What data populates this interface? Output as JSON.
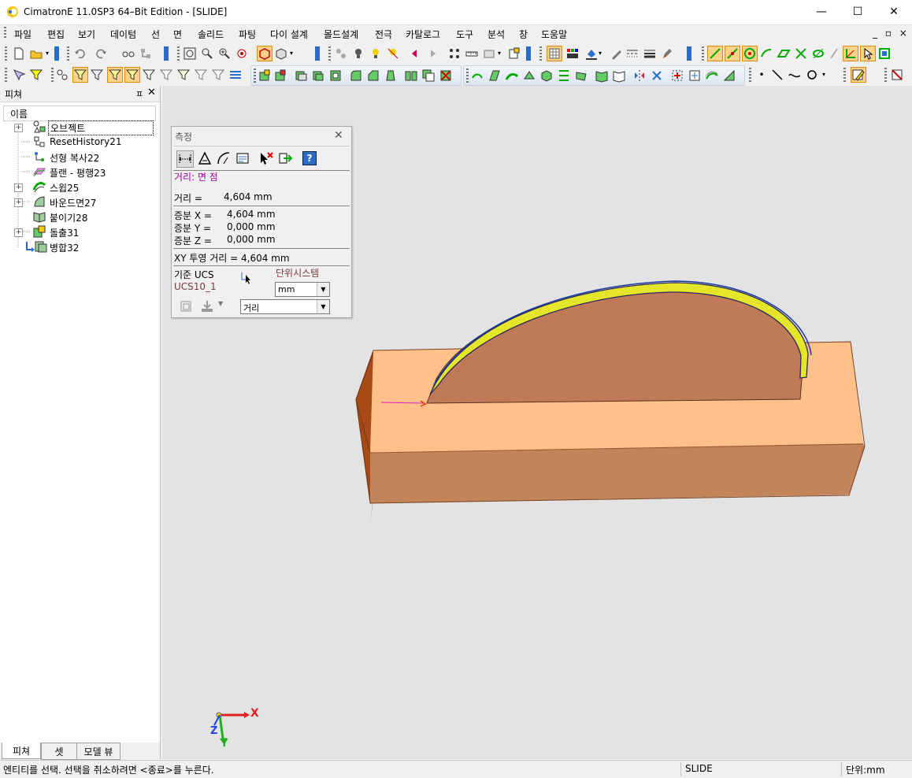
{
  "window": {
    "title": "CimatronE 11.0SP3 64–Bit Edition - [SLIDE]",
    "minimize": "—",
    "maximize": "☐",
    "close": "✕"
  },
  "menu": {
    "items": [
      "파일",
      "편집",
      "보기",
      "데이텀",
      "선",
      "면",
      "솔리드",
      "파팅",
      "다이 설계",
      "몰드설계",
      "전극",
      "카탈로그",
      "도구",
      "분석",
      "창",
      "도움말"
    ],
    "right_controls": "_ ▫ ×"
  },
  "feature_panel": {
    "title": "피쳐",
    "pin": "ㅍ",
    "close": "✕",
    "column_header": "이름",
    "items": [
      {
        "label": "오브젝트",
        "expandable": true,
        "icon": "objects-icon"
      },
      {
        "label": "ResetHistory21",
        "expandable": false,
        "icon": "reset-history-icon"
      },
      {
        "label": "선형 복사22",
        "expandable": false,
        "icon": "linear-copy-icon"
      },
      {
        "label": "플랜 - 평행23",
        "expandable": false,
        "icon": "plane-parallel-icon"
      },
      {
        "label": "스윕25",
        "expandable": true,
        "icon": "sweep-icon"
      },
      {
        "label": "바운드면27",
        "expandable": true,
        "icon": "bounded-face-icon"
      },
      {
        "label": "붙이기28",
        "expandable": false,
        "icon": "attach-icon"
      },
      {
        "label": "돌출31",
        "expandable": true,
        "icon": "extrude-icon"
      },
      {
        "label": "병합32",
        "expandable": false,
        "icon": "merge-icon"
      }
    ],
    "tabs": [
      "피쳐",
      "셋",
      "모델 뷰"
    ]
  },
  "measure_dialog": {
    "title": "측정",
    "close": "✕",
    "mode_label": "거리:  면 점",
    "distance_label": "거리 =",
    "distance_value": "4,604 mm",
    "dx_label": "증분 X =",
    "dx_value": "4,604 mm",
    "dy_label": "증분 Y =",
    "dy_value": "0,000 mm",
    "dz_label": "증분 Z =",
    "dz_value": "0,000 mm",
    "xy_projection": "XY 투영 거리 = 4,604 mm",
    "ucs_label": "기준 UCS",
    "ucs_value": "UCS10_1",
    "units_label": "단위시스템",
    "units_value": "mm",
    "type_value": "거리",
    "help": "?"
  },
  "viewport": {
    "axis_x": "X",
    "axis_y": "Y",
    "axis_z": "Z"
  },
  "statusbar": {
    "message": "엔티티를 선택. 선택을 취소하려면 <종료>를 누른다.",
    "model": "SLIDE",
    "units": "단위:mm"
  },
  "colors": {
    "block_top": "#ffc08a",
    "block_side": "#c07850",
    "block_dark": "#8a3a10",
    "arc_face": "#c07a58",
    "rib": "#e5e629",
    "viewport_bg": "#e3e3e3",
    "toolbar_active": "#ffd28a"
  }
}
